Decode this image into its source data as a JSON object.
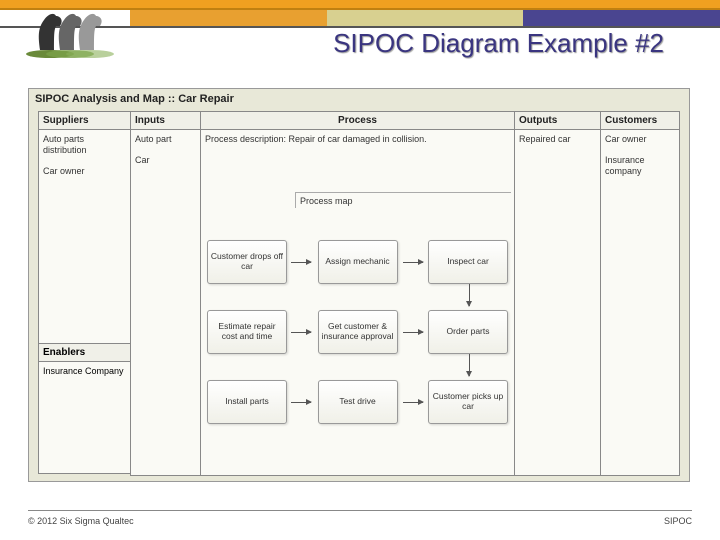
{
  "title": "SIPOC Diagram Example #2",
  "diagram_title": "SIPOC Analysis and Map :: Car Repair",
  "headers": {
    "suppliers": "Suppliers",
    "inputs": "Inputs",
    "process": "Process",
    "outputs": "Outputs",
    "customers": "Customers",
    "enablers": "Enablers"
  },
  "suppliers": [
    "Auto parts distribution",
    "Car owner"
  ],
  "inputs": [
    "Auto part",
    "Car"
  ],
  "process_description": "Process description: Repair of car damaged in collision.",
  "process_map_label": "Process map",
  "process_steps": {
    "r1": [
      "Customer drops off car",
      "Assign mechanic",
      "Inspect car"
    ],
    "r2": [
      "Estimate repair cost and time",
      "Get customer & insurance approval",
      "Order parts"
    ],
    "r3": [
      "Install parts",
      "Test drive",
      "Customer picks up car"
    ]
  },
  "outputs": [
    "Repaired car"
  ],
  "customers": [
    "Car owner",
    "Insurance company"
  ],
  "enablers": [
    "Insurance Company"
  ],
  "footer_left": "© 2012 Six Sigma Qualtec",
  "footer_right": "SIPOC"
}
